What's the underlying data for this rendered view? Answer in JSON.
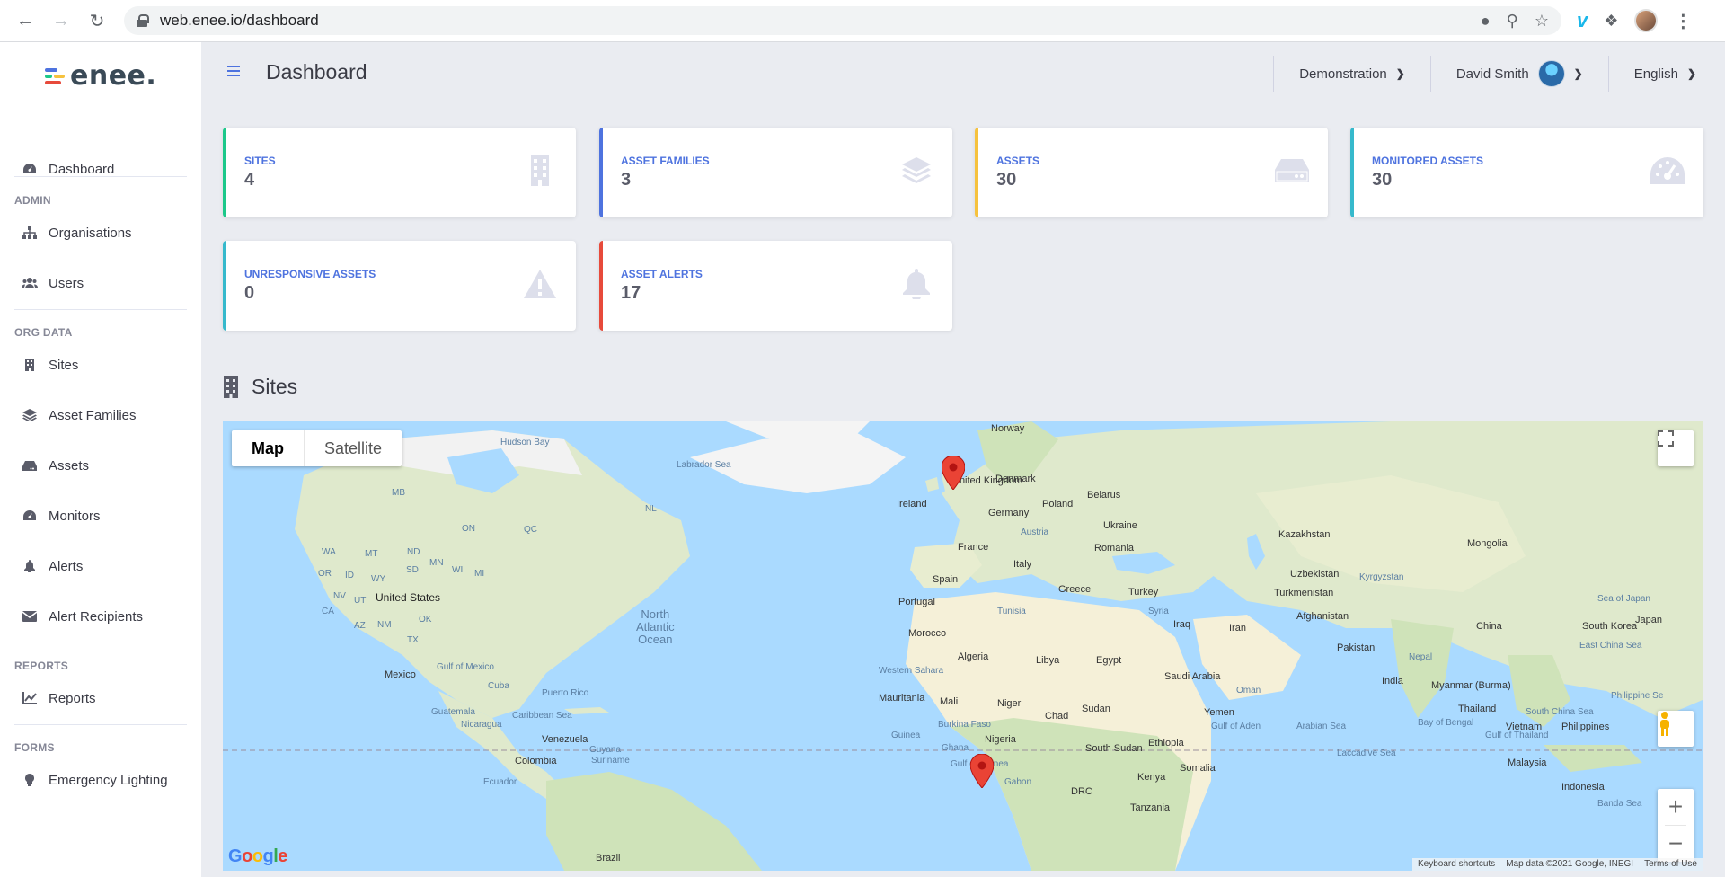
{
  "browser": {
    "url": "web.enee.io/dashboard"
  },
  "brand": {
    "logo_text": "enee."
  },
  "sidebar": {
    "dashboard": "Dashboard",
    "admin_heading": "ADMIN",
    "organisations": "Organisations",
    "users": "Users",
    "org_data_heading": "ORG DATA",
    "sites": "Sites",
    "asset_families": "Asset Families",
    "assets": "Assets",
    "monitors": "Monitors",
    "alerts": "Alerts",
    "alert_recipients": "Alert Recipients",
    "reports_heading": "REPORTS",
    "reports": "Reports",
    "forms_heading": "FORMS",
    "emergency_lighting": "Emergency Lighting"
  },
  "topbar": {
    "title": "Dashboard",
    "organisation": "Demonstration",
    "user": "David Smith",
    "language": "English"
  },
  "cards": [
    {
      "label": "SITES",
      "value": "4",
      "color": "#1cc88a",
      "icon": "building-icon"
    },
    {
      "label": "ASSET FAMILIES",
      "value": "3",
      "color": "#4e73df",
      "icon": "layers-icon"
    },
    {
      "label": "ASSETS",
      "value": "30",
      "color": "#f6c23e",
      "icon": "hdd-icon"
    },
    {
      "label": "MONITORED ASSETS",
      "value": "30",
      "color": "#36b9cc",
      "icon": "gauge-icon"
    },
    {
      "label": "UNRESPONSIVE ASSETS",
      "value": "0",
      "color": "#36b9cc",
      "icon": "warning-icon"
    },
    {
      "label": "ASSET ALERTS",
      "value": "17",
      "color": "#e74a3b",
      "icon": "bell-icon"
    }
  ],
  "sites_section": {
    "title": "Sites"
  },
  "map": {
    "map_label": "Map",
    "satellite_label": "Satellite",
    "google": "Google",
    "footer": {
      "shortcuts": "Keyboard shortcuts",
      "data": "Map data ©2021 Google, INEGI",
      "terms": "Terms of Use"
    },
    "labels": {
      "hudson_bay": "Hudson Bay",
      "labrador_sea": "Labrador Sea",
      "norway": "Norway",
      "united_kingdom": "United Kingdom",
      "denmark": "Denmark",
      "ireland": "Ireland",
      "belarus": "Belarus",
      "poland": "Poland",
      "germany": "Germany",
      "ukraine": "Ukraine",
      "austria": "Austria",
      "kazakhstan": "Kazakhstan",
      "mongolia": "Mongolia",
      "france": "France",
      "romania": "Romania",
      "italy": "Italy",
      "spain": "Spain",
      "greece": "Greece",
      "turkey": "Turkey",
      "uzbekistan": "Uzbekistan",
      "kyrgyzstan": "Kyrgyzstan",
      "turkmenistan": "Turkmenistan",
      "portugal": "Portugal",
      "syria": "Syria",
      "iraq": "Iraq",
      "iran": "Iran",
      "afghanistan": "Afghanistan",
      "china": "China",
      "south_korea": "South Korea",
      "japan": "Japan",
      "sea_of_japan": "Sea of Japan",
      "tunisia": "Tunisia",
      "morocco": "Morocco",
      "algeria": "Algeria",
      "libya": "Libya",
      "egypt": "Egypt",
      "pakistan": "Pakistan",
      "east_china_sea": "East China Sea",
      "nepal": "Nepal",
      "saudi_arabia": "Saudi Arabia",
      "india": "India",
      "western_sahara": "Western Sahara",
      "oman": "Oman",
      "myanmar": "Myanmar (Burma)",
      "mauritania": "Mauritania",
      "mali": "Mali",
      "niger": "Niger",
      "sudan": "Sudan",
      "chad": "Chad",
      "yemen": "Yemen",
      "thailand": "Thailand",
      "philippine_sea": "Philippine Se",
      "south_china_sea": "South China Sea",
      "gulf_of_aden": "Gulf of Aden",
      "arabian_sea": "Arabian Sea",
      "bay_of_bengal": "Bay of Bengal",
      "vietnam": "Vietnam",
      "philippines": "Philippines",
      "burkina_faso": "Burkina Faso",
      "guinea": "Guinea",
      "nigeria": "Nigeria",
      "ghana": "Ghana",
      "ethiopia": "Ethiopia",
      "south_sudan": "South Sudan",
      "gulf_of_thailand": "Gulf of Thailand",
      "laccadive_sea": "Laccadive Sea",
      "gulf_of_guinea": "Gulf of Guinea",
      "somalia": "Somalia",
      "malaysia": "Malaysia",
      "kenya": "Kenya",
      "gabon": "Gabon",
      "drc": "DRC",
      "indonesia": "Indonesia",
      "tanzania": "Tanzania",
      "banda_sea": "Banda Sea",
      "mb": "MB",
      "on": "ON",
      "qc": "QC",
      "nl": "NL",
      "wa": "WA",
      "mt": "MT",
      "nd": "ND",
      "mn": "MN",
      "or": "OR",
      "id": "ID",
      "sd": "SD",
      "wy": "WY",
      "wi": "WI",
      "mi": "MI",
      "nv": "NV",
      "ut": "UT",
      "united_states": "United States",
      "ca": "CA",
      "az": "AZ",
      "nm": "NM",
      "tx": "TX",
      "ok": "OK",
      "mexico": "Mexico",
      "gulf_of_mexico": "Gulf of Mexico",
      "north_atlantic": "North\nAtlantic\nOcean",
      "cuba": "Cuba",
      "puerto_rico": "Puerto Rico",
      "guatemala": "Guatemala",
      "caribbean_sea": "Caribbean Sea",
      "nicaragua": "Nicaragua",
      "venezuela": "Venezuela",
      "guyana": "Guyana",
      "suriname": "Suriname",
      "colombia": "Colombia",
      "ecuador": "Ecuador",
      "brazil": "Brazil"
    }
  },
  "colors": {
    "primary": "#4e73df",
    "land": "#e8eedb",
    "desert": "#f5f0d8",
    "forest": "#cfe3b9",
    "water": "#aadaff",
    "marker": "#ea4335"
  }
}
